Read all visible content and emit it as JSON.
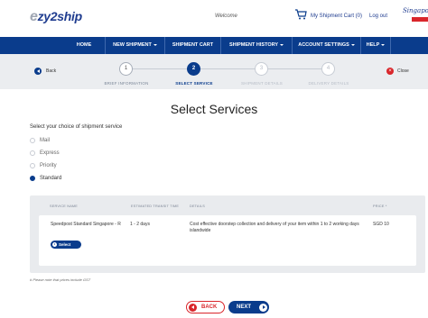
{
  "header": {
    "logo_prefix": "e",
    "logo_text": "zy2ship",
    "welcome": "Welcome",
    "cart_label": "My Shipment Cart (0)",
    "logout_label": "Log out",
    "brand_text": "Singapore"
  },
  "nav": {
    "items": [
      {
        "label": "HOME",
        "dropdown": false
      },
      {
        "label": "NEW SHIPMENT",
        "dropdown": true
      },
      {
        "label": "SHIPMENT CART",
        "dropdown": false
      },
      {
        "label": "SHIPMENT HISTORY",
        "dropdown": true
      },
      {
        "label": "ACCOUNT SETTINGS",
        "dropdown": true
      },
      {
        "label": "HELP",
        "dropdown": true
      }
    ]
  },
  "stepper": {
    "back_label": "Back",
    "close_label": "Close",
    "steps": [
      {
        "number": "1",
        "label": "BRIEF INFORMATION",
        "state": "done"
      },
      {
        "number": "2",
        "label": "SELECT SERVICE",
        "state": "active"
      },
      {
        "number": "3",
        "label": "SHIPMENT DETAILS",
        "state": "pending"
      },
      {
        "number": "4",
        "label": "DELIVERY DETAILS",
        "state": "pending"
      }
    ]
  },
  "main": {
    "title": "Select Services",
    "subtitle": "Select your choice of shipment service",
    "options": [
      {
        "label": "Mail",
        "selected": false
      },
      {
        "label": "Express",
        "selected": false
      },
      {
        "label": "Priority",
        "selected": false
      },
      {
        "label": "Standard",
        "selected": true
      }
    ]
  },
  "table": {
    "headers": {
      "service": "SERVICE NAME",
      "transit": "ESTIMATED TRANSIT TIME",
      "details": "DETAILS",
      "price": "PRICE *"
    },
    "rows": [
      {
        "service": "Speedpost Standard Singapore - R",
        "transit": "1 - 2 days",
        "details": "Cost effective doorstep collection and delivery of your item within 1 to 2 working days islandwide",
        "price": "SGD 10",
        "button": "Select"
      }
    ]
  },
  "note": "# Please note that prices include GST",
  "footer": {
    "back_label": "BACK",
    "next_label": "NEXT"
  },
  "colors": {
    "primary": "#0a3c8c",
    "accent": "#d9262b",
    "stepbar_bg": "#ebedf0"
  }
}
